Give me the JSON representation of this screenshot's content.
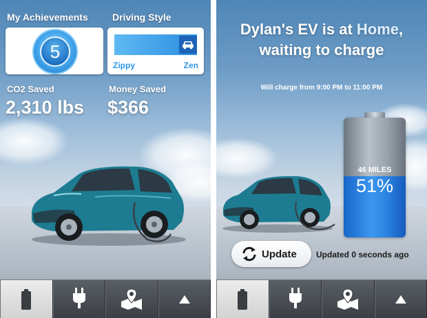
{
  "left": {
    "achievements_label": "My Achievements",
    "achievements_count": "5",
    "driving_style_label": "Driving Style",
    "driving_style_left": "Zippy",
    "driving_style_right": "Zen",
    "co2_label": "CO2 Saved",
    "co2_value": "2,310 lbs",
    "money_label": "Money Saved",
    "money_value": "$366"
  },
  "right": {
    "title_line1_prefix": "Dylan's EV is at ",
    "title_location": "Home",
    "title_line1_suffix": ",",
    "title_line2": "waiting to charge",
    "schedule": "Will charge from 9:00 PM to 11:00 PM",
    "battery_miles": "46 MILES",
    "battery_percent_label": "51%",
    "battery_level": 0.51,
    "update_button": "Update",
    "updated_status": "Updated 0 seconds ago"
  },
  "tabs": [
    {
      "icon": "battery-icon",
      "active": true
    },
    {
      "icon": "plug-icon",
      "active": false
    },
    {
      "icon": "map-pin-icon",
      "active": false
    },
    {
      "icon": "up-arrow-icon",
      "active": false
    }
  ],
  "colors": {
    "accent_blue": "#2f97e6",
    "battery_fill": "#2a83e0",
    "car_teal": "#1d7c91",
    "tabbar": "#3b3f45"
  }
}
